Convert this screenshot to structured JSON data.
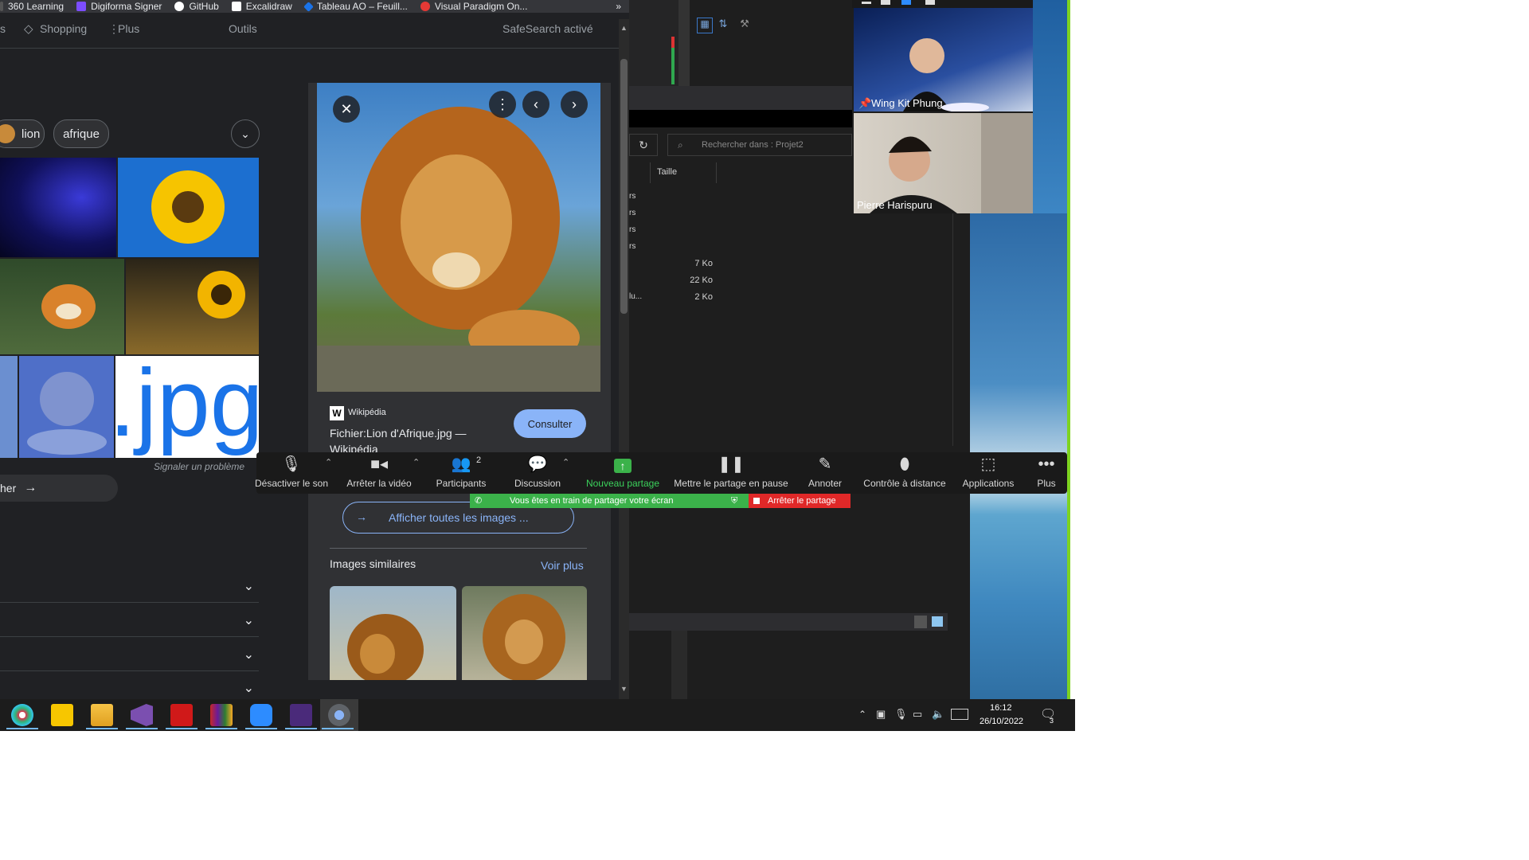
{
  "bookmarks": {
    "items": [
      {
        "label": "360 Learning",
        "icon": "360-learning-icon",
        "color": "#e8eaed"
      },
      {
        "label": "Digiforma Signer",
        "icon": "digiforma-icon",
        "color": "#7c4dff"
      },
      {
        "label": "GitHub",
        "icon": "github-icon",
        "color": "#ffffff"
      },
      {
        "label": "Excalidraw",
        "icon": "excalidraw-icon",
        "color": "#ffffff"
      },
      {
        "label": "Tableau AO – Feuill...",
        "icon": "tableau-icon",
        "color": "#1a73e8"
      },
      {
        "label": "Visual Paradigm On...",
        "icon": "visual-paradigm-icon",
        "color": "#e53935"
      }
    ],
    "more": "»"
  },
  "google": {
    "nav": {
      "shopping": "Shopping",
      "more": "Plus",
      "tools": "Outils",
      "safesearch": "SafeSearch activé",
      "partial": "s"
    },
    "chips": [
      "lion",
      "afrique"
    ],
    "report": "Signaler un problème",
    "search_partial": "her",
    "thumb_text": ".jpg"
  },
  "preview": {
    "source": "Wikipédia",
    "title": "Fichier:Lion d'Afrique.jpg — Wikipédia",
    "visit": "Consulter",
    "show_all": "Afficher toutes les images ...",
    "similar": "Images similaires",
    "see_more": "Voir plus"
  },
  "explorer": {
    "search_placeholder": "Rechercher dans : Projet2",
    "col_size": "Taille",
    "rows": [
      {
        "name": "rs",
        "size": ""
      },
      {
        "name": "rs",
        "size": ""
      },
      {
        "name": "rs",
        "size": ""
      },
      {
        "name": "rs",
        "size": ""
      },
      {
        "name": "",
        "size": "7 Ko"
      },
      {
        "name": "",
        "size": "22 Ko"
      },
      {
        "name": "lu...",
        "size": "2 Ko"
      }
    ]
  },
  "participants": [
    {
      "name": "Wing Kit Phung"
    },
    {
      "name": "Pierre Harispuru"
    }
  ],
  "zoom": {
    "buttons": [
      {
        "label": "Désactiver le son",
        "icon": "microphone-icon"
      },
      {
        "label": "Arrêter la vidéo",
        "icon": "video-camera-icon"
      },
      {
        "label": "Participants",
        "icon": "participants-icon",
        "count": "2"
      },
      {
        "label": "Discussion",
        "icon": "chat-icon"
      },
      {
        "label": "Nouveau partage",
        "icon": "share-screen-icon"
      },
      {
        "label": "Mettre le partage en pause",
        "icon": "pause-icon"
      },
      {
        "label": "Annoter",
        "icon": "pencil-icon"
      },
      {
        "label": "Contrôle à distance",
        "icon": "mouse-icon"
      },
      {
        "label": "Applications",
        "icon": "apps-icon"
      },
      {
        "label": "Plus",
        "icon": "more-dots-icon"
      }
    ],
    "sharing_notice": "Vous êtes en train de partager votre écran",
    "stop_share": "Arrêter le partage",
    "share_green": "#3bb24a",
    "stop_red": "#e02828"
  },
  "taskbar": {
    "time": "16:12",
    "date": "26/10/2022",
    "notifications": "3"
  }
}
